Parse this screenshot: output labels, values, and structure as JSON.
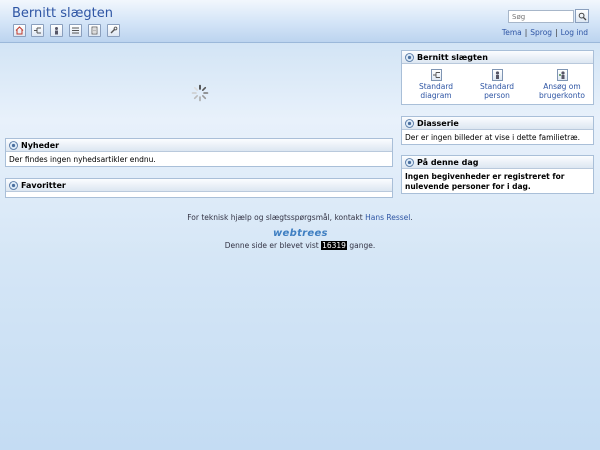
{
  "header": {
    "title": "Bernitt slægten",
    "search_placeholder": "Søg",
    "links": {
      "theme": "Tema",
      "language": "Sprog",
      "login": "Log ind"
    },
    "toolbar_icons": [
      "home-icon",
      "pedigree-chart-icon",
      "individual-icon",
      "list-icon",
      "report-icon",
      "tools-icon"
    ]
  },
  "main": {
    "nyheder": {
      "title": "Nyheder",
      "body": "Der findes ingen nyhedsartikler endnu."
    },
    "favoritter": {
      "title": "Favoritter"
    }
  },
  "sidebar": {
    "family": {
      "title": "Bernitt slægten",
      "items": [
        {
          "label_line1": "Standard",
          "label_line2": "diagram",
          "icon": "pedigree-chart-icon"
        },
        {
          "label_line1": "Standard person",
          "label_line2": "",
          "icon": "individual-icon"
        },
        {
          "label_line1": "Ansøg om",
          "label_line2": "brugerkonto",
          "icon": "user-add-icon"
        }
      ]
    },
    "diasserie": {
      "title": "Diasserie",
      "body": "Der er ingen billeder at vise i dette familietræ."
    },
    "denne_dag": {
      "title": "På denne dag",
      "body": "Ingen begivenheder er registreret for nulevende personer for i dag."
    }
  },
  "footer": {
    "contact_prefix": "For teknisk hjælp og slægtsspørgsmål, kontakt",
    "contact_name": "Hans Ressel",
    "contact_suffix": ".",
    "logo": "webtrees",
    "visits_prefix": "Denne side er blevet vist",
    "visits_count": "16319",
    "visits_suffix": "gange."
  },
  "colors": {
    "accent": "#2e55a4",
    "header_bg": "#d3e4f7",
    "box_border": "#a9bfd8"
  }
}
